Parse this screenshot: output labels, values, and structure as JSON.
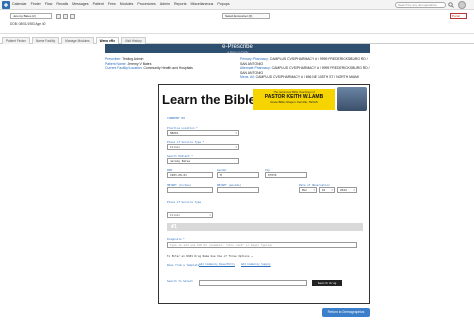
{
  "menubar": {
    "items": [
      "Calendar",
      "Finder",
      "Flow",
      "Recalls",
      "Messages",
      "Patient",
      "Fees",
      "Modules",
      "Procedures",
      "Admin",
      "Reports",
      "Miscellaneous",
      "Popups"
    ],
    "search_placeholder": "Search by any demographics"
  },
  "patient": {
    "name": "Jeremy Bates (2)",
    "dob": "DOB: 08/01/1983 Age 40",
    "encounter": "Select Encounter (0)",
    "facility": "Portal"
  },
  "tabs": [
    "Patient Finder",
    "Name Facility",
    "Manage Modules",
    "Weno eRx",
    "Visit History"
  ],
  "erx": {
    "title": "e-Prescribe",
    "subtitle": "◄ Return to Profile"
  },
  "info_left": [
    {
      "label": "Prescriber:",
      "value": "Testing Admin"
    },
    {
      "label": "Patient Name:",
      "value": "Jeremy V Bates"
    },
    {
      "label": "Current Facility/Location:",
      "value": "Community Health and Hospitals"
    }
  ],
  "info_right": [
    {
      "label": "Primary Pharmacy:",
      "value": "CAMPLUS CVS/PHARMACY # / 9999 FREDERICKSBURG RD / SAN ANTONIO"
    },
    {
      "label": "Alternate Pharmacy:",
      "value": "CAMPLUS CVS/PHARMACY # / 9999 FREDERICKSBURG RD / SAN ANTONIO"
    },
    {
      "label": "Mens. All:",
      "value": "CAMPLUS CVS/PHARMACY # / 656 NE 105TH ST / NORTH MIAMI"
    }
  ],
  "banner": {
    "title": "Learn the Bible",
    "line1": "The Advanced Bible Teachings of",
    "line2": "PASTOR KEITH W.LAMB",
    "line3": "Grace Bible Chapel • Kerrville, TEXAS"
  },
  "form": {
    "section": "CURRENT RX",
    "location_label": "Practice Location *",
    "location_value": "88601",
    "service_label": "Place of Service Type *",
    "service_value": "Clinic",
    "patient_label": "Search Patient *",
    "patient_value": "Jeremy Bates",
    "dob_label": "DOB",
    "dob_value": "1983-08-01",
    "gender_label": "Gender",
    "gender_value": "M",
    "zip_label": "Zip",
    "zip_value": "07036",
    "height_label": "HEIGHT (inches)",
    "weight_label": "WEIGHT (pounds)",
    "vitals_label": "Date of Observation",
    "vitals_month": "Mon",
    "vitals_day": "01",
    "vitals_year": "2024",
    "pos_label": "Place of Service Type",
    "pos_value": "Clinic",
    "divider": "#1",
    "diagnosis_label": "Diagnosis *",
    "diagnosis_placeholder": "Type to add one ICD Dx (example: \"skin rash\" or begin typing)",
    "instruction": "To Enter an RX#1 Drug Name Use One of Three Options →",
    "option1_label": "Rxes from a template",
    "option1_link": "Add Commonly Rxes/Entry",
    "option2_link": "Add Commonly Supply",
    "search_label": "Search to Select",
    "search_button": "Search Drug"
  },
  "return_button": "Return to Demographics"
}
